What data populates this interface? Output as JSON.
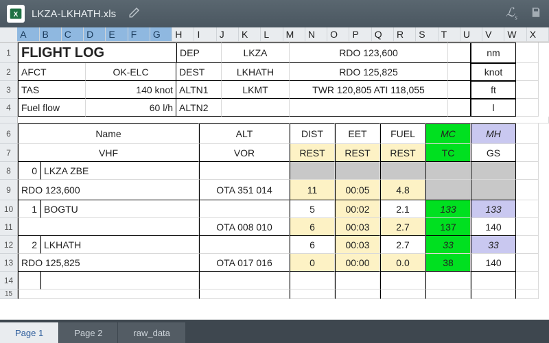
{
  "titlebar": {
    "filename": "LKZA-LKHATH.xls"
  },
  "columns": [
    "A",
    "B",
    "C",
    "D",
    "E",
    "F",
    "G",
    "H",
    "I",
    "J",
    "K",
    "L",
    "M",
    "N",
    "O",
    "P",
    "Q",
    "R",
    "S",
    "T",
    "U",
    "V",
    "W",
    "X"
  ],
  "selected_cols": [
    "A",
    "B",
    "C",
    "D",
    "E",
    "F",
    "G"
  ],
  "rows": [
    "1",
    "2",
    "3",
    "4",
    "",
    "6",
    "7",
    "8",
    "9",
    "10",
    "11",
    "12",
    "13",
    "14",
    "15"
  ],
  "header": {
    "title": "FLIGHT LOG",
    "afct_label": "AFCT",
    "afct_val": "OK-ELC",
    "tas_label": "TAS",
    "tas_val": "140 knot",
    "ff_label": "Fuel flow",
    "ff_val": "60 l/h",
    "dep_label": "DEP",
    "dep_val": "LKZA",
    "dest_label": "DEST",
    "dest_val": "LKHATH",
    "altn1_label": "ALTN1",
    "altn1_val": "LKMT",
    "altn2_label": "ALTN2",
    "rdo1": "RDO 123,600",
    "rdo2": "RDO 125,825",
    "twr": "TWR 120,805  ATI 118,055",
    "u_nm": "nm",
    "u_knot": "knot",
    "u_ft": "ft",
    "u_l": "l"
  },
  "th": {
    "name": "Name",
    "alt": "ALT",
    "dist": "DIST",
    "eet": "EET",
    "fuel": "FUEL",
    "mc": "MC",
    "mh": "MH",
    "vhf": "VHF",
    "vor": "VOR",
    "rest": "REST",
    "tc": "TC",
    "gs": "GS"
  },
  "r8": {
    "idx": "0",
    "name": "LKZA ZBE"
  },
  "r9": {
    "rdo": "RDO 123,600",
    "vor": "OTA 351 014",
    "dist": "11",
    "eet": "00:05",
    "fuel": "4.8"
  },
  "r10": {
    "idx": "1",
    "name": "BOGTU",
    "dist": "5",
    "eet": "00:02",
    "fuel": "2.1",
    "mc": "133",
    "mh": "133"
  },
  "r11": {
    "vor": "OTA 008 010",
    "dist": "6",
    "eet": "00:03",
    "fuel": "2.7",
    "tc": "137",
    "gs": "140"
  },
  "r12": {
    "idx": "2",
    "name": "LKHATH",
    "dist": "6",
    "eet": "00:03",
    "fuel": "2.7",
    "mc": "33",
    "mh": "33"
  },
  "r13": {
    "rdo": "RDO 125,825",
    "vor": "OTA 017 016",
    "dist": "0",
    "eet": "00:00",
    "fuel": "0.0",
    "tc": "38",
    "gs": "140"
  },
  "tabs": {
    "t1": "Page 1",
    "t2": "Page 2",
    "t3": "raw_data"
  },
  "chart_data": {
    "type": "table",
    "title": "FLIGHT LOG",
    "meta": {
      "AFCT": "OK-ELC",
      "TAS_knot": 140,
      "FuelFlow_lh": 60,
      "DEP": "LKZA",
      "DEST": "LKHATH",
      "ALTN1": "LKMT",
      "RDO": [
        123600,
        125825
      ],
      "TWR": 120805,
      "ATI": 118055
    },
    "columns": [
      "idx",
      "Name",
      "VHF/RDO",
      "VOR",
      "DIST",
      "EET",
      "FUEL",
      "MC/TC",
      "MH/GS"
    ],
    "rows": [
      [
        0,
        "LKZA ZBE",
        "RDO 123,600",
        "OTA 351 014",
        11,
        "00:05",
        4.8,
        null,
        null
      ],
      [
        1,
        "BOGTU",
        null,
        "OTA 008 010",
        5,
        "00:02",
        2.1,
        133,
        133
      ],
      [
        null,
        null,
        null,
        null,
        6,
        "00:03",
        2.7,
        137,
        140
      ],
      [
        2,
        "LKHATH",
        "RDO 125,825",
        "OTA 017 016",
        6,
        "00:03",
        2.7,
        33,
        33
      ],
      [
        null,
        null,
        null,
        null,
        0,
        "00:00",
        0.0,
        38,
        140
      ]
    ]
  }
}
